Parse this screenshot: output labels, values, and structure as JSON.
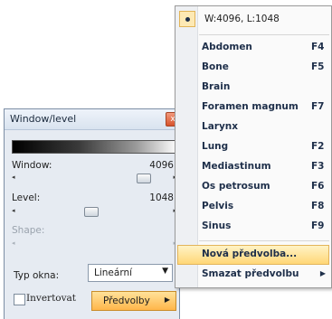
{
  "window_level_panel": {
    "title": "Window/level",
    "close_glyph": "x",
    "window_label": "Window:",
    "window_value": "4096",
    "window_slider_fraction": 0.88,
    "level_label": "Level:",
    "level_value": "1048",
    "level_slider_fraction": 0.48,
    "shape_label": "Shape:",
    "arrow_left": "◂",
    "arrow_right": "▸",
    "typ_okna_label": "Typ okna:",
    "typ_okna_value": "Lineární",
    "select_arrow": "▼",
    "invert_label": "Invertovat",
    "presets_button_label": "Předvolby",
    "presets_button_arrow": "▶"
  },
  "presets_menu": {
    "current_value": "W:4096, L:1048",
    "items": [
      {
        "label": "Abdomen",
        "key": "F4"
      },
      {
        "label": "Bone",
        "key": "F5"
      },
      {
        "label": "Brain",
        "key": ""
      },
      {
        "label": "Foramen magnum",
        "key": "F7"
      },
      {
        "label": "Larynx",
        "key": ""
      },
      {
        "label": "Lung",
        "key": "F2"
      },
      {
        "label": "Mediastinum",
        "key": "F3"
      },
      {
        "label": "Os petrosum",
        "key": "F6"
      },
      {
        "label": "Pelvis",
        "key": "F8"
      },
      {
        "label": "Sinus",
        "key": "F9"
      }
    ],
    "new_preset_label": "Nová předvolba...",
    "delete_preset_label": "Smazat předvolbu",
    "submenu_arrow": "▶"
  }
}
